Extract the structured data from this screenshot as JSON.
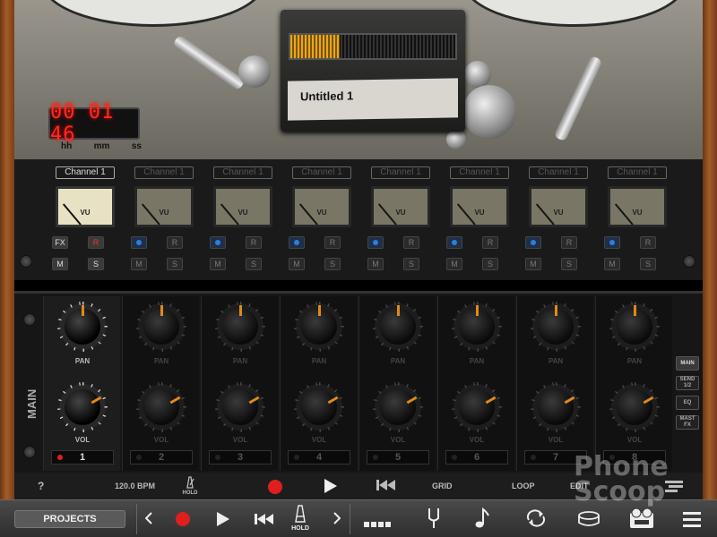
{
  "recorder": {
    "title": "Untitled 1",
    "counter": "00:01:46",
    "counter_display": "00 01 46",
    "units": [
      "hh",
      "mm",
      "ss"
    ],
    "level_fraction": 0.3
  },
  "channels": [
    {
      "name": "Channel 1",
      "number": "1",
      "fx": "FX",
      "r": "R",
      "m": "M",
      "s": "S",
      "active": true
    },
    {
      "name": "Channel 1",
      "number": "2",
      "r": "R",
      "m": "M",
      "s": "S",
      "active": false
    },
    {
      "name": "Channel 1",
      "number": "3",
      "r": "R",
      "m": "M",
      "s": "S",
      "active": false
    },
    {
      "name": "Channel 1",
      "number": "4",
      "r": "R",
      "m": "M",
      "s": "S",
      "active": false
    },
    {
      "name": "Channel 1",
      "number": "5",
      "r": "R",
      "m": "M",
      "s": "S",
      "active": false
    },
    {
      "name": "Channel 1",
      "number": "6",
      "r": "R",
      "m": "M",
      "s": "S",
      "active": false
    },
    {
      "name": "Channel 1",
      "number": "7",
      "r": "R",
      "m": "M",
      "s": "S",
      "active": false
    },
    {
      "name": "Channel 1",
      "number": "8",
      "r": "R",
      "m": "M",
      "s": "S",
      "active": false
    }
  ],
  "vu_label": "VU",
  "mixer": {
    "section_label": "MAIN",
    "pan_label": "PAN",
    "vol_label": "VOL",
    "side_buttons": [
      "MAIN",
      "SEND 1/2",
      "EQ",
      "MAST FX"
    ]
  },
  "transport": {
    "help": "?",
    "tempo": "120.0 BPM",
    "hold": "HOLD",
    "grid": "GRID",
    "loop": "LOOP",
    "edit": "EDIT"
  },
  "bottombar": {
    "projects": "PROJECTS",
    "hold": "HOLD"
  },
  "watermark": "Phone Scoop"
}
